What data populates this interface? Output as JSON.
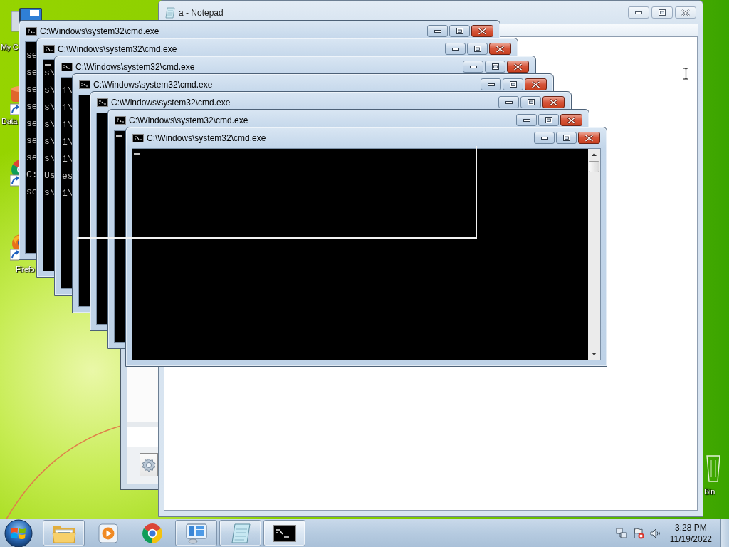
{
  "desktop": {
    "icons": [
      {
        "kind": "computer",
        "label": "My C"
      },
      {
        "kind": "shortcut",
        "label": "Data"
      },
      {
        "kind": "chrome-shortcut"
      },
      {
        "kind": "firefox-shortcut",
        "label": "Firefo"
      },
      {
        "kind": "recycle-bin",
        "label": "Bin"
      }
    ]
  },
  "notepad": {
    "title": "a - Notepad"
  },
  "cmd_windows": [
    {
      "title": "C:\\Windows\\system32\\cmd.exe",
      "cursor": false,
      "lines": [
        "se",
        "se",
        "se",
        "se",
        "se",
        "se",
        "se",
        "C:",
        "se"
      ]
    },
    {
      "title": "C:\\Windows\\system32\\cmd.exe",
      "cursor": true,
      "lines": [
        "s\\",
        "s\\",
        "s\\",
        "s\\",
        "s\\",
        "s\\",
        "Us",
        "s\\"
      ]
    },
    {
      "title": "C:\\Windows\\system32\\cmd.exe",
      "cursor": false,
      "lines": [
        "1\\",
        "1\\",
        "1\\",
        "1\\",
        "1\\",
        "es",
        "1\\"
      ]
    },
    {
      "title": "C:\\Windows\\system32\\cmd.exe",
      "cursor": false
    },
    {
      "title": "C:\\Windows\\system32\\cmd.exe",
      "cursor": false
    },
    {
      "title": "C:\\Windows\\system32\\cmd.exe",
      "cursor": true
    },
    {
      "title": "C:\\Windows\\system32\\cmd.exe",
      "cursor": true
    }
  ],
  "taskbar": {
    "buttons": [
      {
        "kind": "explorer",
        "open": true,
        "selected": false
      },
      {
        "kind": "media-player",
        "open": false,
        "selected": false
      },
      {
        "kind": "chrome",
        "open": false,
        "selected": false
      },
      {
        "kind": "control-panel",
        "open": true,
        "selected": false
      },
      {
        "kind": "notepad",
        "open": true,
        "selected": false
      },
      {
        "kind": "cmd",
        "open": true,
        "selected": true
      }
    ],
    "clock": {
      "time": "3:28 PM",
      "date": "11/19/2022"
    }
  }
}
